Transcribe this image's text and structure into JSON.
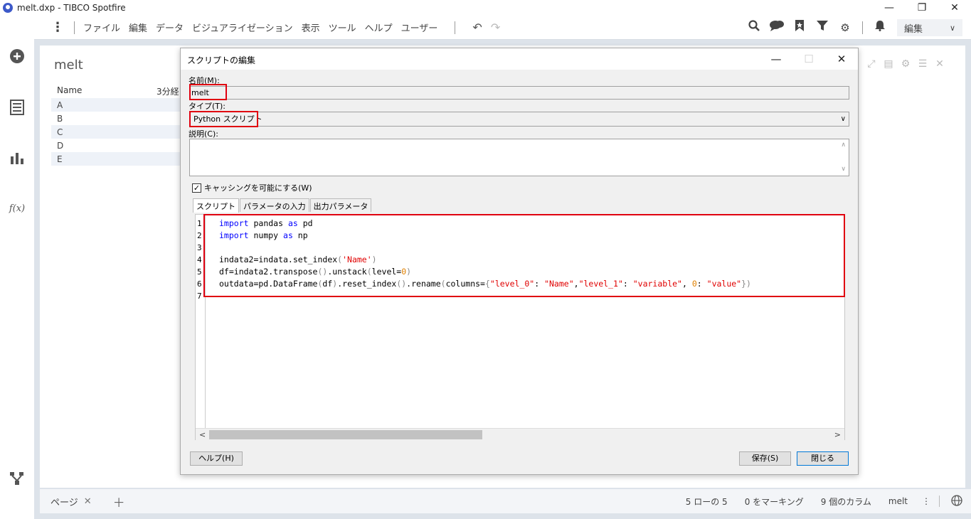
{
  "window": {
    "title": "melt.dxp - TIBCO Spotfire",
    "minimize": "—",
    "restore": "❐",
    "close": "✕"
  },
  "menu": {
    "items": [
      "ファイル",
      "編集",
      "データ",
      "ビジュアライゼーション",
      "表示",
      "ツール",
      "ヘルプ",
      "ユーザー"
    ],
    "edit_mode": "編集"
  },
  "visualization": {
    "title": "melt",
    "col_name": "Name",
    "col_value": "3分経",
    "rows": [
      "A",
      "B",
      "C",
      "D",
      "E"
    ]
  },
  "bottom": {
    "page_tab": "ページ",
    "status_rows": "5 ローの 5",
    "status_marked": "0 をマーキング",
    "status_columns": "9 個のカラム",
    "status_table": "melt"
  },
  "dialog": {
    "title": "スクリプトの編集",
    "name_label": "名前(M):",
    "name_value": "melt",
    "type_label": "タイプ(T):",
    "type_value": "Python スクリプト",
    "desc_label": "説明(C):",
    "desc_value": "",
    "caching_label": "キャッシングを可能にする(W)",
    "caching_checked": true,
    "tabs": [
      "スクリプト",
      "パラメータの入力",
      "出力パラメータ"
    ],
    "line_numbers": [
      "1",
      "2",
      "3",
      "4",
      "5",
      "6",
      "7"
    ],
    "help_button": "ヘルプ(H)",
    "save_button": "保存(S)",
    "close_button": "閉じる"
  },
  "colors": {
    "highlight": "#e00010",
    "keyword": "#0000ff",
    "string": "#e00000",
    "number": "#e08000",
    "primary_border": "#0078d7"
  }
}
